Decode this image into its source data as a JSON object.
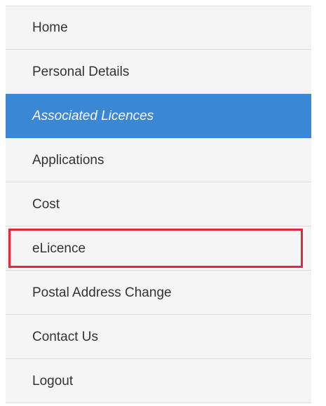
{
  "colors": {
    "background": "#f5f5f5",
    "active_bg": "#3a87d6",
    "active_text": "#ffffff",
    "text": "#333333",
    "divider": "#dcdcdc",
    "highlight": "#e02b36"
  },
  "nav": {
    "items": [
      {
        "label": "Home"
      },
      {
        "label": "Personal Details"
      },
      {
        "label": "Associated Licences"
      },
      {
        "label": "Applications"
      },
      {
        "label": "Cost"
      },
      {
        "label": "eLicence"
      },
      {
        "label": "Postal Address Change"
      },
      {
        "label": "Contact Us"
      },
      {
        "label": "Logout"
      }
    ],
    "active_item": "Associated Licences",
    "highlighted_item": "eLicence"
  }
}
